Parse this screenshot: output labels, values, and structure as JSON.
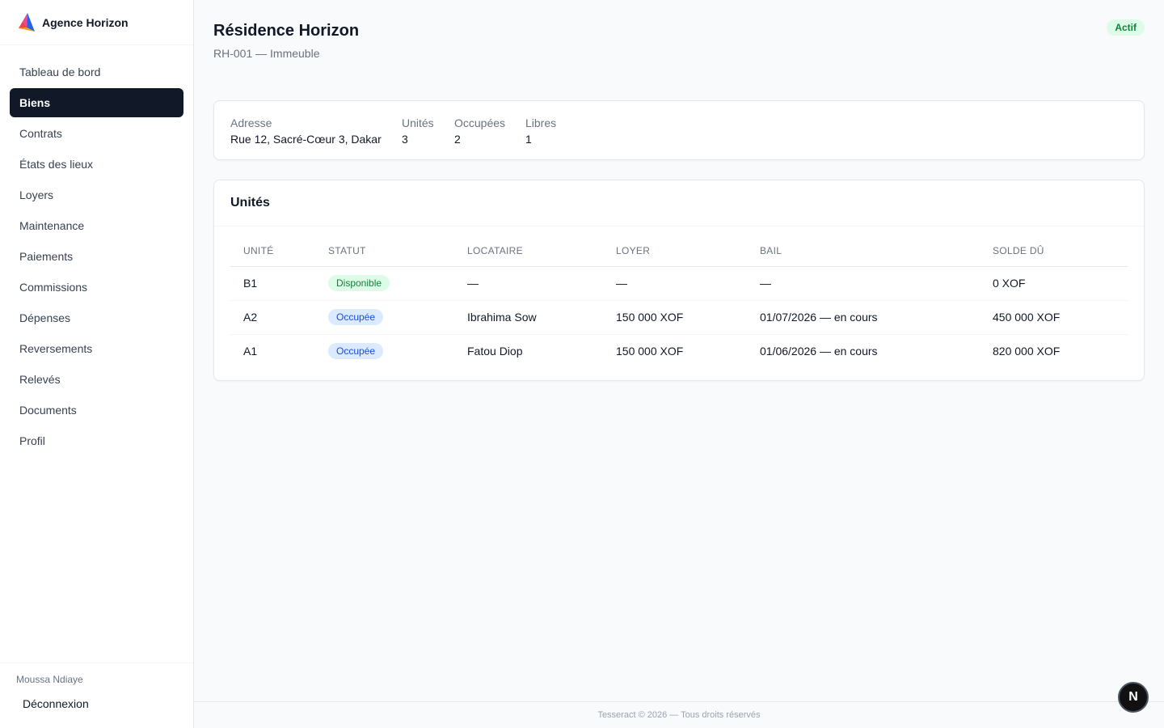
{
  "brand": {
    "name": "Agence Horizon",
    "logo_icon": "triangle-logo-icon"
  },
  "nav": {
    "items": [
      {
        "label": "Tableau de bord",
        "active": false
      },
      {
        "label": "Biens",
        "active": true
      },
      {
        "label": "Contrats",
        "active": false
      },
      {
        "label": "États des lieux",
        "active": false
      },
      {
        "label": "Loyers",
        "active": false
      },
      {
        "label": "Maintenance",
        "active": false
      },
      {
        "label": "Paiements",
        "active": false
      },
      {
        "label": "Commissions",
        "active": false
      },
      {
        "label": "Dépenses",
        "active": false
      },
      {
        "label": "Reversements",
        "active": false
      },
      {
        "label": "Relevés",
        "active": false
      },
      {
        "label": "Documents",
        "active": false
      },
      {
        "label": "Profil",
        "active": false
      }
    ]
  },
  "user": {
    "name": "Moussa Ndiaye",
    "logout_label": "Déconnexion"
  },
  "page": {
    "title": "Résidence Horizon",
    "subtitle": "RH-001 — Immeuble",
    "status": "Actif"
  },
  "info": {
    "address_label": "Adresse",
    "address_value": "Rue 12, Sacré-Cœur 3, Dakar",
    "units_label": "Unités",
    "units_value": "3",
    "occupied_label": "Occupées",
    "occupied_value": "2",
    "free_label": "Libres",
    "free_value": "1"
  },
  "units": {
    "title": "Unités",
    "columns": [
      "Unité",
      "Statut",
      "Locataire",
      "Loyer",
      "Bail",
      "Solde dû"
    ],
    "rows": [
      {
        "unit": "B1",
        "status": "Disponible",
        "tenant": "—",
        "rent": "—",
        "lease": "—",
        "balance": "0 XOF"
      },
      {
        "unit": "A2",
        "status": "Occupée",
        "tenant": "Ibrahima Sow",
        "rent": "150 000 XOF",
        "lease": "01/07/2026 — en cours",
        "balance": "450 000 XOF"
      },
      {
        "unit": "A1",
        "status": "Occupée",
        "tenant": "Fatou Diop",
        "rent": "150 000 XOF",
        "lease": "01/06/2026 — en cours",
        "balance": "820 000 XOF"
      }
    ]
  },
  "footer": {
    "text": "Tesseract © 2026 — Tous droits réservés"
  },
  "fab": {
    "label": "N"
  },
  "colors": {
    "sidebar_active_bg": "#111827",
    "status_green_bg": "#dcfce7",
    "status_green_text": "#15803d",
    "status_blue_bg": "#dbeafe",
    "status_blue_text": "#1d4ed8"
  }
}
